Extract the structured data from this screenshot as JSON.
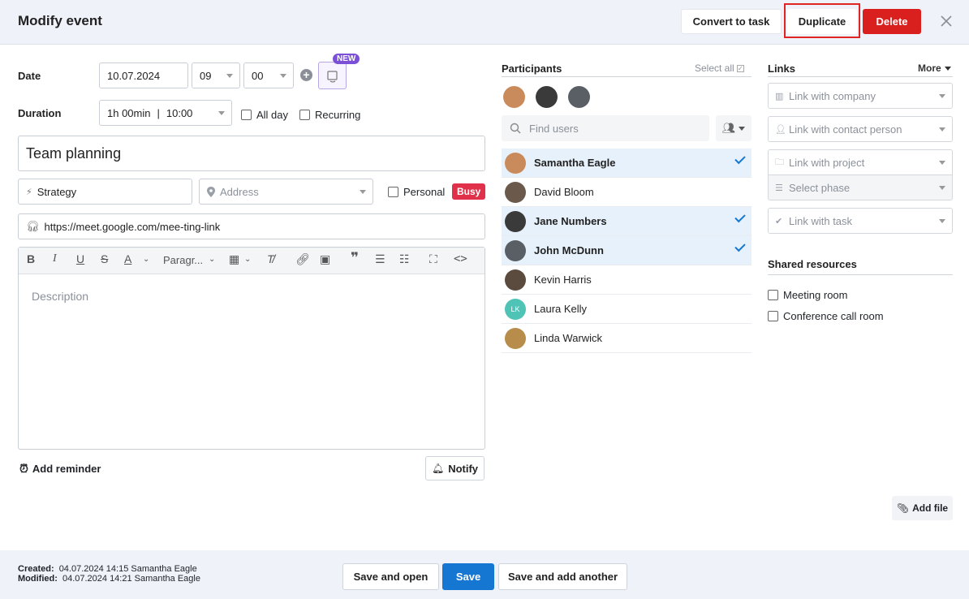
{
  "header": {
    "title": "Modify event",
    "convert_label": "Convert to task",
    "duplicate_label": "Duplicate",
    "delete_label": "Delete"
  },
  "form": {
    "date_label": "Date",
    "date_value": "10.07.2024",
    "hour_value": "09",
    "minute_value": "00",
    "new_badge": "NEW",
    "duration_label": "Duration",
    "duration_value": "1h 00min",
    "duration_time": "10:00",
    "allday_label": "All day",
    "recurring_label": "Recurring",
    "title_value": "Team planning",
    "category_value": "Strategy",
    "address_placeholder": "Address",
    "personal_label": "Personal",
    "busy_label": "Busy",
    "link_value": "https://meet.google.com/mee-ting-link",
    "toolbar_paragraph": "Paragr...",
    "description_placeholder": "Description",
    "add_reminder_label": "Add reminder",
    "notify_label": "Notify"
  },
  "participants": {
    "title": "Participants",
    "select_all": "Select all",
    "find_placeholder": "Find users",
    "list": [
      {
        "name": "Samantha Eagle",
        "selected": true,
        "color": "#c98b5b"
      },
      {
        "name": "David Bloom",
        "selected": false,
        "color": "#6b5a4c"
      },
      {
        "name": "Jane Numbers",
        "selected": true,
        "color": "#3a3a3a"
      },
      {
        "name": "John McDunn",
        "selected": true,
        "color": "#5a5f66"
      },
      {
        "name": "Kevin Harris",
        "selected": false,
        "color": "#5b4b3e"
      },
      {
        "name": "Laura Kelly",
        "selected": false,
        "color": "#4fc3b6",
        "initials": "LK"
      },
      {
        "name": "Linda Warwick",
        "selected": false,
        "color": "#b88c4a"
      }
    ]
  },
  "links": {
    "title": "Links",
    "more_label": "More",
    "company": "Link with company",
    "contact": "Link with contact person",
    "project": "Link with project",
    "phase": "Select phase",
    "task": "Link with task"
  },
  "shared": {
    "title": "Shared resources",
    "meeting_room": "Meeting room",
    "conference_room": "Conference call room"
  },
  "add_file_label": "Add file",
  "footer": {
    "created_label": "Created:",
    "created_value": "04.07.2024 14:15 Samantha Eagle",
    "modified_label": "Modified:",
    "modified_value": "04.07.2024 14:21 Samantha Eagle",
    "save_open_label": "Save and open",
    "save_label": "Save",
    "save_another_label": "Save and add another"
  }
}
